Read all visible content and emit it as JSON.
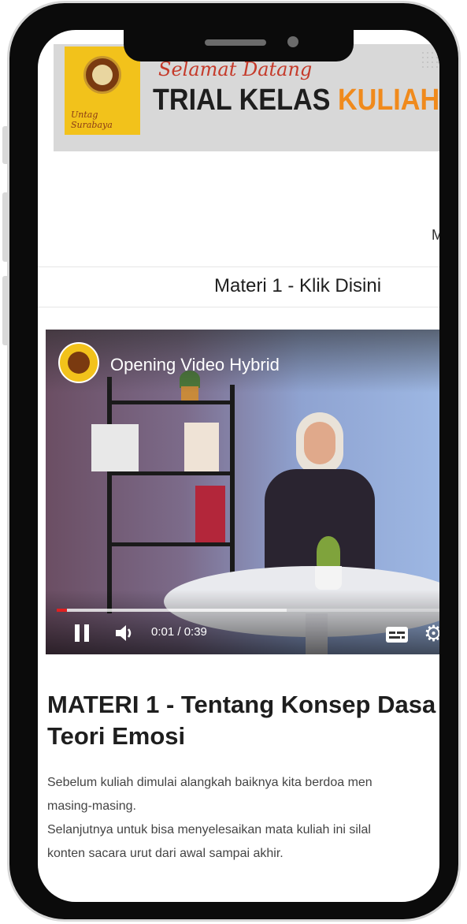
{
  "banner": {
    "welcome": "Selamat Datang",
    "title_part1": "TRIAL KELAS ",
    "title_part2": "KULIAH H",
    "logo_script": "Untag Surabaya"
  },
  "nav": {
    "cut_text": "M"
  },
  "materi": {
    "label": "Materi 1 - Klik Disini"
  },
  "video": {
    "title": "Opening Video Hybrid",
    "time": "0:01 / 0:39",
    "progress_played": 0.026,
    "progress_buffered": 0.6
  },
  "content": {
    "heading_line1": "MATERI 1 - Tentang Konsep Dasa",
    "heading_line2": "Teori Emosi",
    "para_lines": [
      "Sebelum kuliah dimulai alangkah baiknya kita berdoa men",
      "masing-masing.",
      "Selanjutnya untuk bisa menyelesaikan mata kuliah ini silal",
      "konten sacara urut dari awal sampai akhir."
    ]
  },
  "colors": {
    "accent_orange": "#f08a1c",
    "banner_yellow": "#f2c21b",
    "progress_red": "#e02020"
  }
}
